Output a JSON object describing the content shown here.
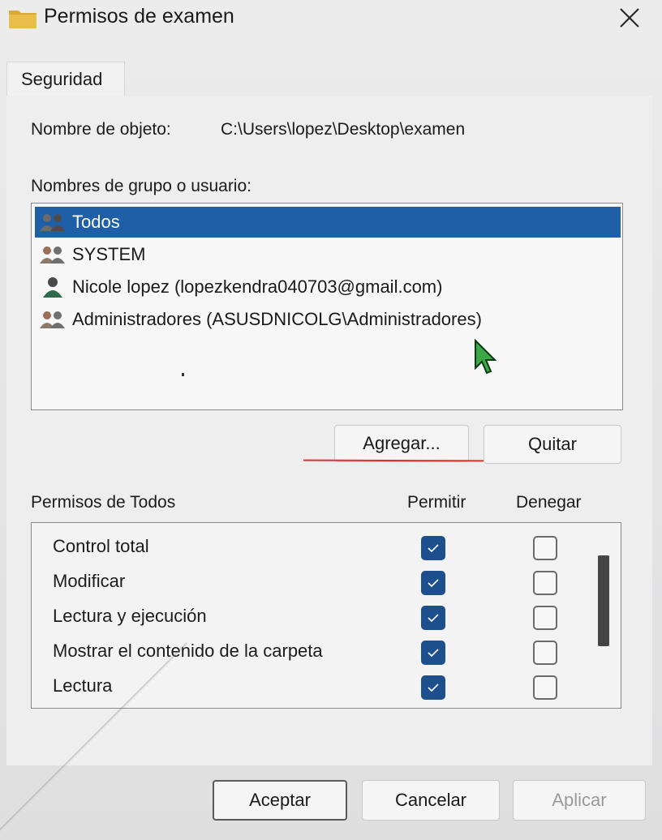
{
  "window": {
    "title": "Permisos de examen",
    "close_icon": "close-icon"
  },
  "tabs": [
    {
      "label": "Seguridad",
      "active": true
    }
  ],
  "object": {
    "label": "Nombre de objeto:",
    "value": "C:\\Users\\lopez\\Desktop\\examen"
  },
  "users": {
    "label": "Nombres de grupo o usuario:",
    "items": [
      {
        "name": "Todos",
        "icon": "group-users-icon",
        "selected": true
      },
      {
        "name": "SYSTEM",
        "icon": "group-users-icon",
        "selected": false
      },
      {
        "name": "Nicole lopez (lopezkendra040703@gmail.com)",
        "icon": "user-icon",
        "selected": false
      },
      {
        "name": "Administradores (ASUSDNICOLG\\Administradores)",
        "icon": "group-users-icon",
        "selected": false
      }
    ]
  },
  "buttons": {
    "add": "Agregar...",
    "remove": "Quitar",
    "ok": "Aceptar",
    "cancel": "Cancelar",
    "apply": "Aplicar"
  },
  "permissions": {
    "title": "Permisos de Todos",
    "allow_header": "Permitir",
    "deny_header": "Denegar",
    "rows": [
      {
        "label": "Control total",
        "allow": true,
        "deny": false
      },
      {
        "label": "Modificar",
        "allow": true,
        "deny": false
      },
      {
        "label": "Lectura y ejecución",
        "allow": true,
        "deny": false
      },
      {
        "label": "Mostrar el contenido de la carpeta",
        "allow": true,
        "deny": false
      },
      {
        "label": "Lectura",
        "allow": true,
        "deny": false
      }
    ]
  },
  "colors": {
    "selection": "#1f5fa8",
    "checkbox_checked": "#1d4f8c",
    "annotation_underline": "#e0302a"
  }
}
